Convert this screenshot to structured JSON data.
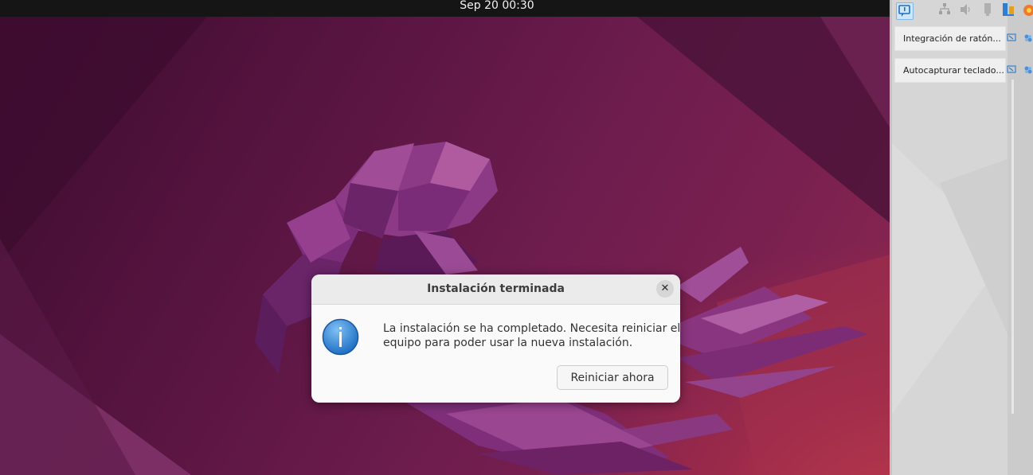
{
  "topbar": {
    "clock": "Sep 20  00:30"
  },
  "dialog": {
    "title": "Instalación terminada",
    "close_glyph": "✕",
    "message_line1": "La instalación se ha completado. Necesita reiniciar el",
    "message_line2": "equipo para poder usar la nueva instalación.",
    "restart_label": "Reiniciar ahora",
    "icon": "info-icon"
  },
  "side_panel": {
    "toolbar_icons": [
      "notification-icon",
      "network-icon",
      "audio-icon",
      "usb-icon",
      "shared-folders-icon",
      "capture-icon"
    ],
    "notifications": [
      {
        "label": "Integración de ratón..."
      },
      {
        "label": "Autocapturar teclado..."
      }
    ]
  },
  "colors": {
    "accent_blue": "#2f7fd0",
    "dialog_bg": "#fafafa",
    "topbar": "#151515"
  }
}
